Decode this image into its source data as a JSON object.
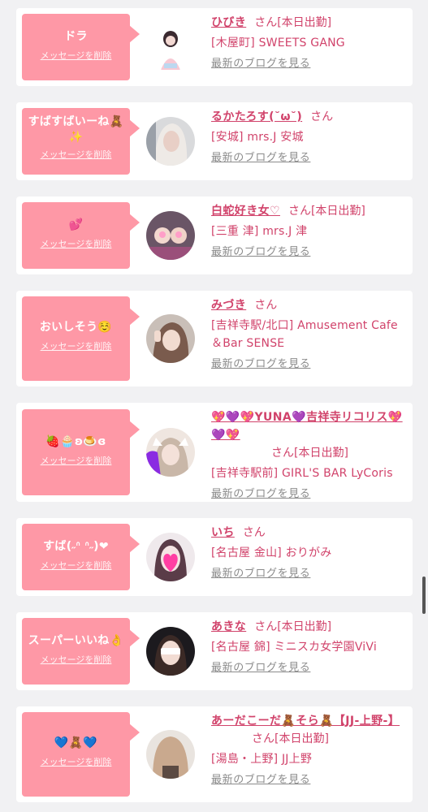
{
  "ui": {
    "san": "さん",
    "delete_label": "メッセージを削除",
    "blog_link": "最新のブログを見る"
  },
  "items": [
    {
      "message": "ドラ",
      "name": "ひびき",
      "status": "[本日出勤]",
      "shop": "[木屋町] SWEETS GANG"
    },
    {
      "message": "すばすばいーね🧸✨",
      "name": "るかたろす(˘ω˘)",
      "status": "",
      "shop": "[安城] mrs.J 安城"
    },
    {
      "message": "💕",
      "name": "白蛇好き女♡",
      "status": "[本日出勤]",
      "shop": "[三重 津] mrs.J 津"
    },
    {
      "message": "おいしそう☺️",
      "name": "みづき",
      "status": "",
      "shop": "[吉祥寺駅/北口] Amusement Cafe ＆Bar SENSE"
    },
    {
      "message": "🍓🧁ʚ🍮ɞ",
      "name": "💖💜💖YUNA💜吉祥寺リコリス💖💜💖",
      "status": "[本日出勤]",
      "shop": "[吉祥寺駅前] GIRL'S BAR LyCoris"
    },
    {
      "message": "すば(˶ᐢ ᐢ˶)❤",
      "name": "いち",
      "status": "",
      "shop": "[名古屋 金山] おりがみ"
    },
    {
      "message": "スーパーいいね👌",
      "name": "あきな",
      "status": "[本日出勤]",
      "shop": "[名古屋 錦] ミニスカ女学園ViVi"
    },
    {
      "message": "💙🧸💙",
      "name": "あーだこーだ🧸そら🧸【JJ-上野-】",
      "status": "[本日出勤]",
      "shop": "[湯島・上野] JJ上野"
    }
  ]
}
